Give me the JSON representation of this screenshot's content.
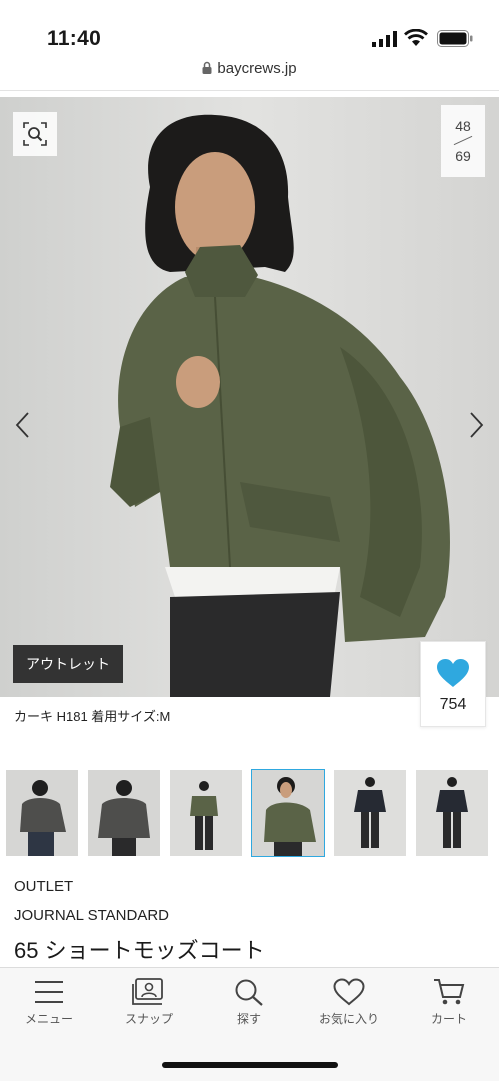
{
  "status_bar": {
    "time": "11:40"
  },
  "browser": {
    "url": "baycrews.jp"
  },
  "gallery": {
    "current": "48",
    "total": "69",
    "badge": "アウトレット",
    "favorites_count": "754",
    "caption": "カーキ H181 着用サイズ:M"
  },
  "product": {
    "label": "OUTLET",
    "brand": "JOURNAL STANDARD",
    "name": "65 ショートモッズコート"
  },
  "bottom_nav": [
    {
      "label": "メニュー",
      "icon": "menu-icon"
    },
    {
      "label": "スナップ",
      "icon": "snap-icon"
    },
    {
      "label": "探す",
      "icon": "search-icon"
    },
    {
      "label": "お気に入り",
      "icon": "heart-icon"
    },
    {
      "label": "カート",
      "icon": "cart-icon"
    }
  ],
  "colors": {
    "accent": "#2fa8df",
    "jacket": "#5a6347",
    "badge_bg": "#333333"
  }
}
